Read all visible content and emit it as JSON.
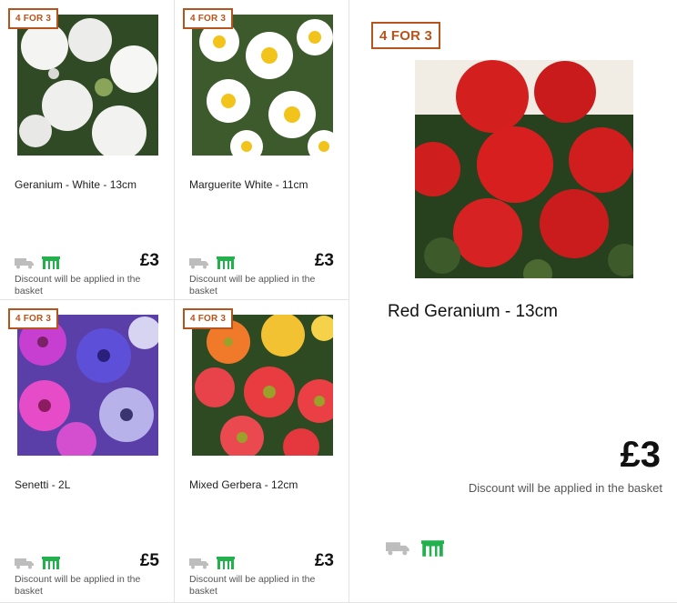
{
  "badge_label": "4 FOR 3",
  "products": [
    {
      "name": "Geranium - White - 13cm",
      "price": "£3",
      "discount": "Discount will be applied in the basket"
    },
    {
      "name": "Marguerite White - 11cm",
      "price": "£3",
      "discount": "Discount will be applied in the basket"
    },
    {
      "name": "Senetti - 2L",
      "price": "£5",
      "discount": "Discount will be applied in the basket"
    },
    {
      "name": "Mixed Gerbera - 12cm",
      "price": "£3",
      "discount": "Discount will be applied in the basket"
    }
  ],
  "featured": {
    "name": "Red Geranium - 13cm",
    "price": "£3",
    "discount": "Discount will be applied in the basket"
  },
  "icons": {
    "delivery": "delivery-truck-icon",
    "store": "store-collect-icon"
  },
  "colors": {
    "badge": "#b5541c",
    "store_icon": "#22b14c",
    "truck_icon": "#bdbdbd"
  }
}
